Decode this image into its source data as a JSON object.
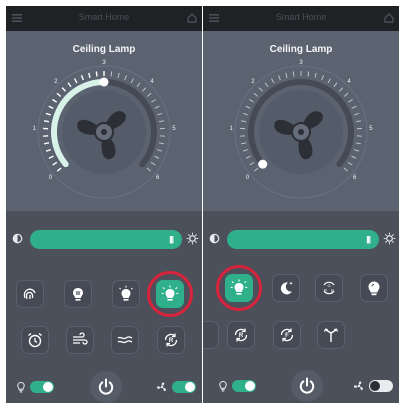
{
  "panels": [
    {
      "header_title": "Smart Home",
      "device_title": "Ceiling Lamp",
      "dial": {
        "ticks": [
          "0",
          "1",
          "2",
          "3",
          "4",
          "5",
          "6"
        ],
        "level": 3,
        "min": 0,
        "max": 6
      },
      "brightness": 1.0,
      "slider_grip": "|||",
      "mode_buttons": [
        {
          "icon": "fingerprint-icon",
          "active": false
        },
        {
          "icon": "bulb-w-icon",
          "active": false
        },
        {
          "icon": "bulb-dim-icon",
          "active": false
        },
        {
          "icon": "bulb-bright-icon",
          "active": true
        }
      ],
      "function_buttons": [
        {
          "icon": "alarm-clock-icon"
        },
        {
          "icon": "wind-icon"
        },
        {
          "icon": "breeze-icon"
        },
        {
          "icon": "reverse-r-icon"
        }
      ],
      "light_switch_on": true,
      "fan_switch_on": true
    },
    {
      "header_title": "Smart Home",
      "device_title": "Ceiling Lamp",
      "dial": {
        "ticks": [
          "0",
          "1",
          "2",
          "3",
          "4",
          "5",
          "6"
        ],
        "level": 0,
        "min": 0,
        "max": 6
      },
      "brightness": 1.0,
      "slider_grip": "|||",
      "mode_buttons": [
        {
          "icon": "bulb-bright-icon",
          "active": true
        },
        {
          "icon": "moon-star-icon",
          "active": false
        },
        {
          "icon": "rgb-cycle-icon",
          "active": false
        },
        {
          "icon": "bulb-solid-icon",
          "active": false
        }
      ],
      "function_buttons": [
        {
          "icon": "reverse-r-icon"
        },
        {
          "icon": "forward-f-icon"
        },
        {
          "icon": "split-arrows-icon"
        }
      ],
      "light_switch_on": true,
      "fan_switch_on": false
    }
  ],
  "colors": {
    "accent": "#2fb08b",
    "highlight_ring": "#d7233b",
    "panel_upper": "#5b6270",
    "panel_lower": "#4b505b",
    "header": "#1f2125"
  }
}
